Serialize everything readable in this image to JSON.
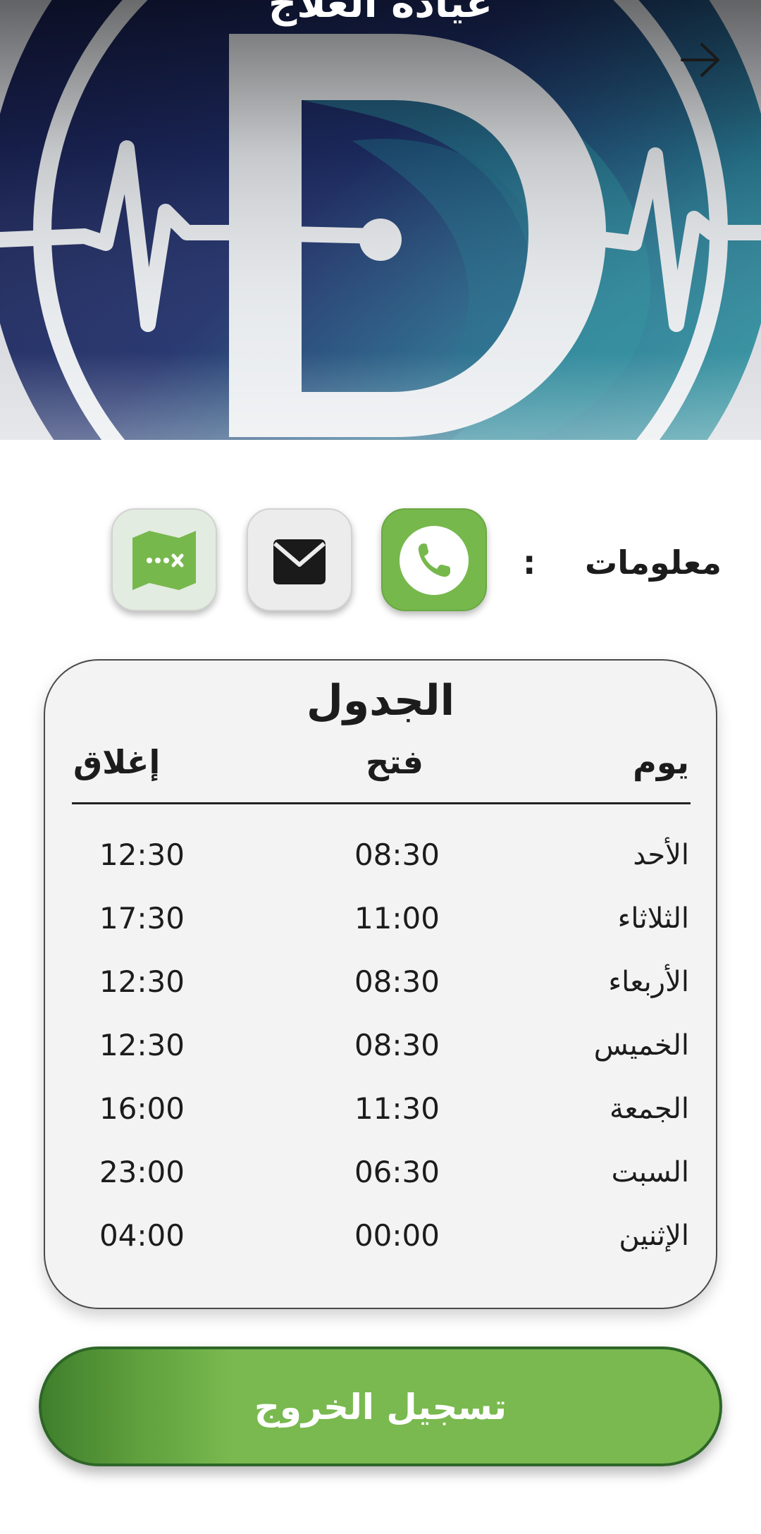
{
  "header": {
    "title": "عيادة العلاج",
    "back_icon": "arrow-right-icon"
  },
  "info": {
    "label": "معلومات",
    "colon": ":",
    "buttons": [
      {
        "icon": "phone-icon",
        "color": "#77b84d"
      },
      {
        "icon": "mail-icon",
        "color": "#ececec"
      },
      {
        "icon": "map-icon",
        "color": "#e3ece0"
      }
    ]
  },
  "schedule": {
    "title": "الجدول",
    "columns": {
      "day": "يوم",
      "open": "فتح",
      "close": "إغلاق"
    },
    "rows": [
      {
        "day": "الأحد",
        "open": "08:30",
        "close": "12:30"
      },
      {
        "day": "الثلاثاء",
        "open": "11:00",
        "close": "17:30"
      },
      {
        "day": "الأربعاء",
        "open": "08:30",
        "close": "12:30"
      },
      {
        "day": "الخميس",
        "open": "08:30",
        "close": "12:30"
      },
      {
        "day": "الجمعة",
        "open": "11:30",
        "close": "16:00"
      },
      {
        "day": "السبت",
        "open": "06:30",
        "close": "23:00"
      },
      {
        "day": "الإثنين",
        "open": "00:00",
        "close": "04:00"
      }
    ]
  },
  "logout": {
    "label": "تسجيل الخروج"
  },
  "colors": {
    "accent_green": "#77b84d",
    "logo_navy": "#1d1f4a",
    "logo_teal": "#2a8f9a"
  }
}
